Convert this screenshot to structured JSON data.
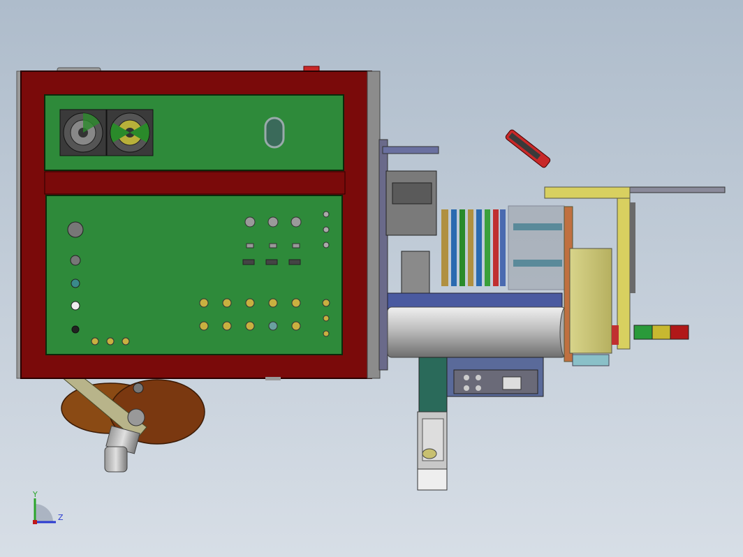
{
  "viewport": {
    "background_top": "#aebccb",
    "background_bottom": "#d7dee6"
  },
  "model": {
    "frame_color": "#7a0a0a",
    "panel_color": "#2e8a3a",
    "steel_color": "#8c8c8c",
    "tube_color": "#c8c8c8",
    "housing_color": "#d8d27a",
    "reel_color": "#7a3a12",
    "stack_light_colors": [
      "#2a9a3a",
      "#c8b830",
      "#b01818"
    ]
  },
  "triad": {
    "y_label": "Y",
    "z_label": "Z",
    "y_color": "#2aa52a",
    "z_color": "#2a3ad0",
    "x_color": "#c01818"
  }
}
